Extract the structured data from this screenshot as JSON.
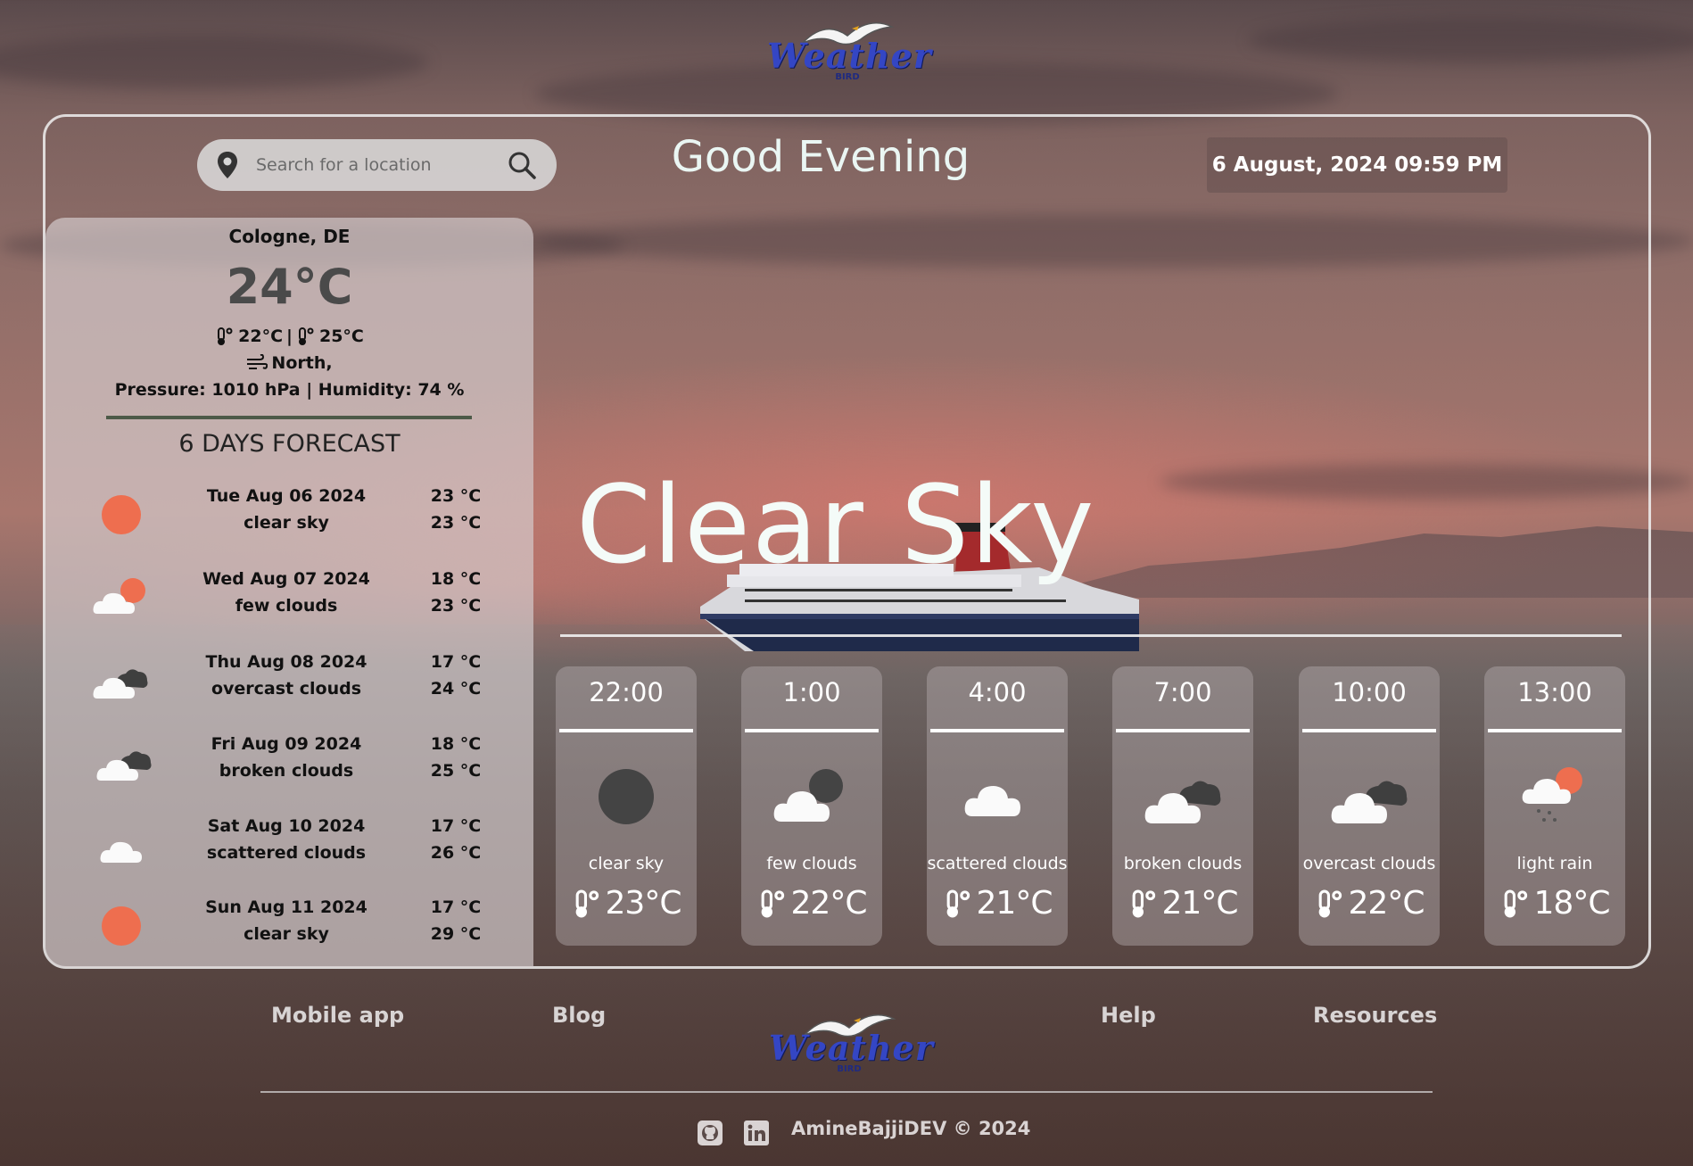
{
  "header": {
    "logo_word": "Weather",
    "logo_sub": "BIRD",
    "search_placeholder": "Search for a location",
    "greeting": "Good Evening",
    "datetime": "6 August, 2024  09:59 PM"
  },
  "current": {
    "city": "Cologne, DE",
    "temp": "24°C",
    "min": "22°C",
    "separator": "|",
    "max": "25°C",
    "wind": "North,",
    "pressure_humidity": "Pressure: 1010 hPa | Humidity: 74 %",
    "condition": "Clear Sky"
  },
  "forecast": {
    "title": "6 DAYS FORECAST",
    "days": [
      {
        "date": "Tue Aug 06 2024",
        "desc": "clear sky",
        "t1": "23 °C",
        "t2": "23 °C",
        "icon": "sun-icon"
      },
      {
        "date": "Wed Aug 07 2024",
        "desc": "few clouds",
        "t1": "18 °C",
        "t2": "23 °C",
        "icon": "few-clouds-icon"
      },
      {
        "date": "Thu Aug 08 2024",
        "desc": "overcast clouds",
        "t1": "17 °C",
        "t2": "24 °C",
        "icon": "overcast-clouds-icon"
      },
      {
        "date": "Fri Aug 09 2024",
        "desc": "broken clouds",
        "t1": "18 °C",
        "t2": "25 °C",
        "icon": "broken-clouds-icon"
      },
      {
        "date": "Sat Aug 10 2024",
        "desc": "scattered clouds",
        "t1": "17 °C",
        "t2": "26 °C",
        "icon": "scattered-clouds-icon"
      },
      {
        "date": "Sun Aug 11 2024",
        "desc": "clear sky",
        "t1": "17 °C",
        "t2": "29 °C",
        "icon": "sun-icon"
      }
    ]
  },
  "hourly": [
    {
      "time": "22:00",
      "desc": "clear sky",
      "temp": "23°C",
      "icon": "moon-icon"
    },
    {
      "time": "1:00",
      "desc": "few clouds",
      "temp": "22°C",
      "icon": "few-clouds-night-icon"
    },
    {
      "time": "4:00",
      "desc": "scattered clouds",
      "temp": "21°C",
      "icon": "scattered-clouds-icon"
    },
    {
      "time": "7:00",
      "desc": "broken clouds",
      "temp": "21°C",
      "icon": "broken-clouds-icon"
    },
    {
      "time": "10:00",
      "desc": "overcast clouds",
      "temp": "22°C",
      "icon": "overcast-clouds-icon"
    },
    {
      "time": "13:00",
      "desc": "light rain",
      "temp": "18°C",
      "icon": "light-rain-icon"
    }
  ],
  "footer": {
    "links": [
      "Mobile app",
      "Blog",
      "Help",
      "Resources"
    ],
    "copyright": "AmineBajjiDEV © 2024"
  },
  "colors": {
    "sun": "#ee6e4f",
    "moon": "#444444",
    "logo_blue": "#3446c4"
  }
}
